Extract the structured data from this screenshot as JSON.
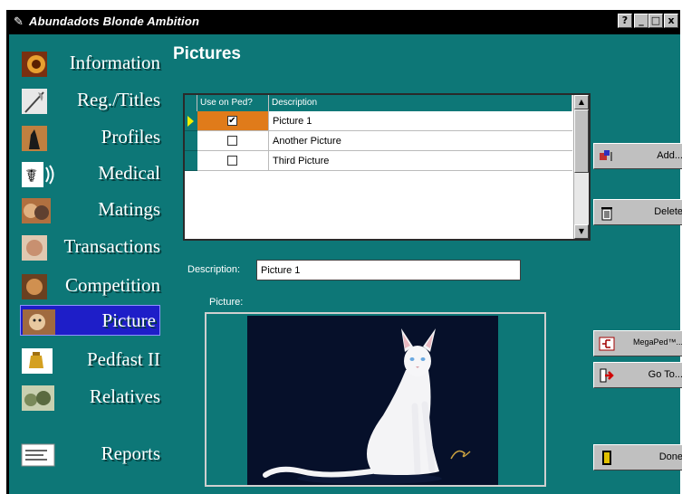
{
  "window": {
    "title": "Abundadots Blonde Ambition",
    "controls": [
      "?",
      "_",
      "□",
      "x"
    ]
  },
  "nav": {
    "items": [
      {
        "label": "Information",
        "icon": "information-icon"
      },
      {
        "label": "Reg./Titles",
        "icon": "quill-pen-icon"
      },
      {
        "label": "Profiles",
        "icon": "cat-profile-icon"
      },
      {
        "label": "Medical",
        "icon": "medical-symbol-icon"
      },
      {
        "label": "Matings",
        "icon": "cats-mating-icon"
      },
      {
        "label": "Transactions",
        "icon": "transactions-icon"
      },
      {
        "label": "Competition",
        "icon": "competition-icon"
      },
      {
        "label": "Picture",
        "icon": "cat-photo-icon",
        "active": true
      },
      {
        "label": "Pedfast II",
        "icon": "pedfast-icon"
      },
      {
        "label": "Relatives",
        "icon": "relatives-icon"
      },
      {
        "label": "Reports",
        "icon": "reports-icon"
      }
    ]
  },
  "page": {
    "heading": "Pictures"
  },
  "grid": {
    "columns": [
      "Use on Ped?",
      "Description"
    ],
    "rows": [
      {
        "use_on_ped": true,
        "check_mark": "✔",
        "description": "Picture 1",
        "selected": true
      },
      {
        "use_on_ped": false,
        "check_mark": "",
        "description": "Another Picture",
        "selected": false
      },
      {
        "use_on_ped": false,
        "check_mark": "",
        "description": "Third Picture",
        "selected": false
      }
    ],
    "selected_color": "#e07b1a"
  },
  "buttons": {
    "add": "Add...",
    "delete": "Delete",
    "megaped": "MegaPed™...",
    "goto": "Go To...",
    "done": "Done"
  },
  "form": {
    "description_label": "Description:",
    "description_value": "Picture 1",
    "picture_label": "Picture:"
  },
  "colors": {
    "window_bg": "#0d7777",
    "nav_active": "#1e1ec8",
    "photo_bg": "#06102a"
  }
}
